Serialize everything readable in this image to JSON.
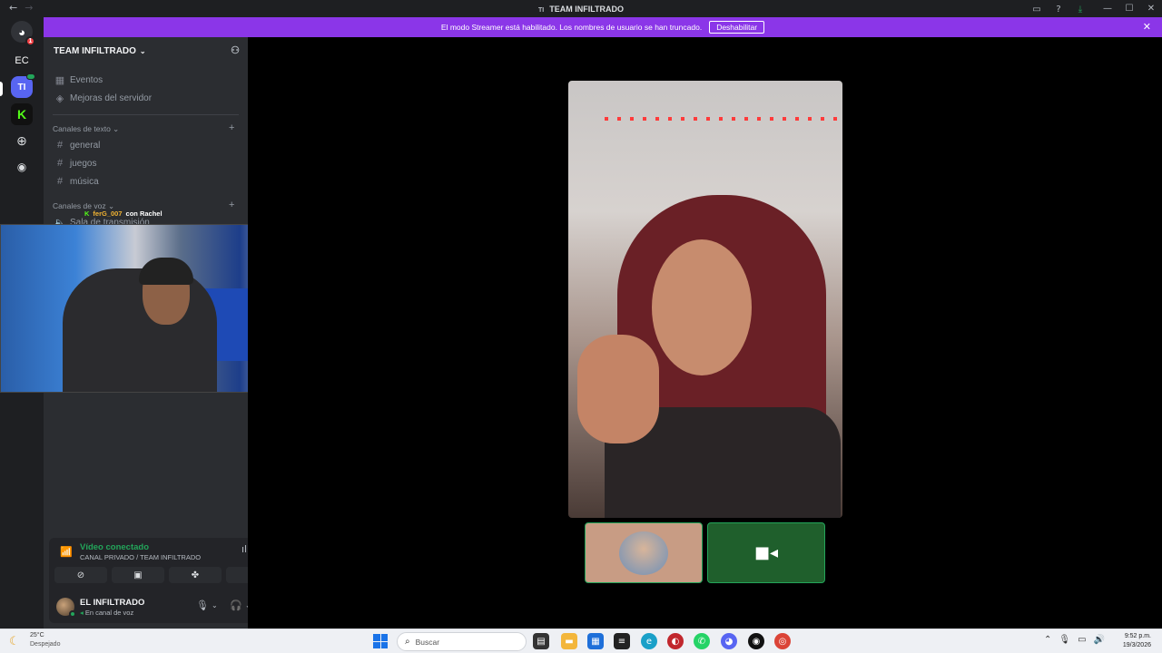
{
  "window": {
    "title": "TEAM INFILTRADO",
    "server_abbrev": "TI"
  },
  "banner": {
    "message": "El modo Streamer está habilitado. Los nombres de usuario se han truncado.",
    "button": "Deshabilitar"
  },
  "guilds": {
    "home_badge": "1",
    "ec": "EC",
    "ti": "TI",
    "kick": "K"
  },
  "server": {
    "name": "TEAM INFILTRADO",
    "top_items": [
      {
        "label": "Eventos",
        "icon": "calendar-icon"
      },
      {
        "label": "Mejoras del servidor",
        "icon": "boost-icon"
      }
    ],
    "text_category": "Canales de texto",
    "text_channels": [
      "general",
      "juegos",
      "música"
    ],
    "voice_category": "Canales de voz",
    "voice_channel": "Sala de transmisión"
  },
  "stream_overlay": {
    "platform": "K",
    "streamer": "ferG_007",
    "with": "con Rachel"
  },
  "voice_panel": {
    "status": "Vídeo conectado",
    "channel": "CANAL PRIVADO / TEAM INFILTRADO"
  },
  "user": {
    "name": "EL INFILTRADO",
    "status": "En canal de voz"
  },
  "taskbar": {
    "weather_temp": "25°C",
    "weather_cond": "Despejado",
    "search_placeholder": "Buscar",
    "time": "9:52 p.m.",
    "date": "19/3/2026"
  }
}
